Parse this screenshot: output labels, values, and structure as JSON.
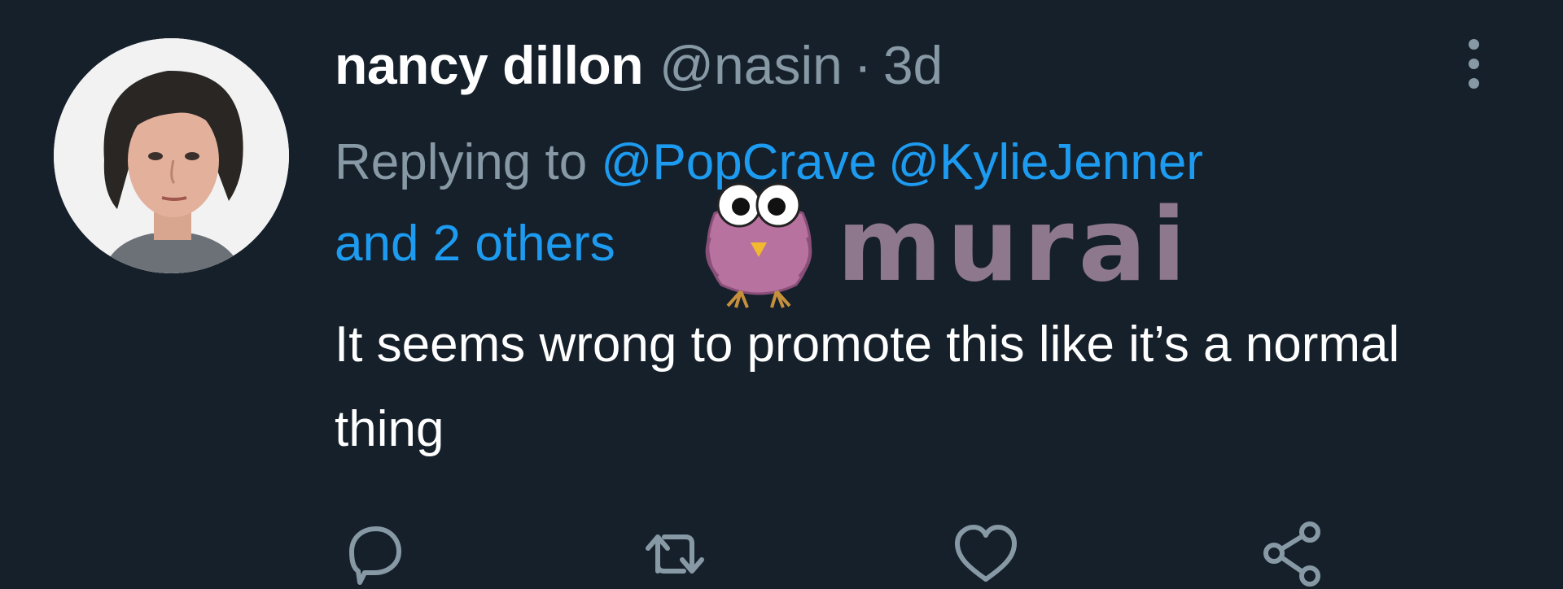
{
  "tweet": {
    "author": {
      "display_name": "nancy dillon",
      "handle": "@nasin"
    },
    "separator": "·",
    "timestamp": "3d",
    "reply_prefix": "Replying to",
    "mentions": [
      "@PopCrave",
      "@KylieJenner"
    ],
    "others": "and 2 others",
    "text": "It seems wrong to promote this like it’s a normal thing"
  },
  "watermark": {
    "text": "murai"
  },
  "icons": {
    "more": "more-vertical-icon",
    "reply": "reply-icon",
    "retweet": "retweet-icon",
    "like": "heart-icon",
    "share": "share-icon"
  },
  "colors": {
    "background": "#15202b",
    "primary_text": "#ffffff",
    "secondary_text": "#8899a6",
    "link": "#1d9bf0"
  }
}
